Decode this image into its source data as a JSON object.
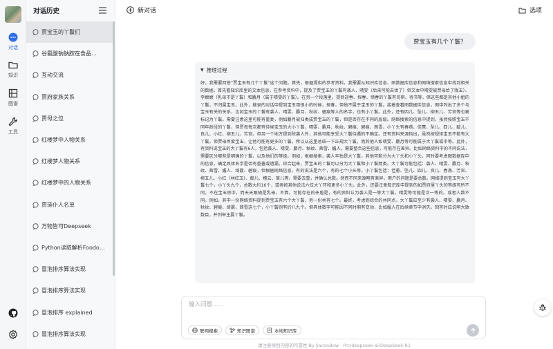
{
  "rail": {
    "items": [
      {
        "icon": "chat-icon",
        "label": "对话"
      },
      {
        "icon": "folder-icon",
        "label": "知识"
      },
      {
        "icon": "graph-icon",
        "label": "图谱"
      },
      {
        "icon": "wrench-icon",
        "label": "工具"
      }
    ],
    "bottom_icons": [
      "github-icon",
      "gear-icon"
    ],
    "accent": "#2f6fed"
  },
  "sidebar": {
    "title": "对话历史",
    "items": [
      {
        "label": "贾宝玉的丫鬟们"
      },
      {
        "label": "谷氨酸钠钠胺在食品…"
      },
      {
        "label": "互动交流"
      },
      {
        "label": "贾府家族关系"
      },
      {
        "label": "贾母之位"
      },
      {
        "label": "红楼梦中人物关系"
      },
      {
        "label": "红楼梦人物关系"
      },
      {
        "label": "红楼梦中的人物关系"
      },
      {
        "label": "贾琏仆人名单"
      },
      {
        "label": "万物皆可Deepseek"
      },
      {
        "label": "Python读取解析Foodo…"
      },
      {
        "label": "冒泡排序算法实现"
      },
      {
        "label": "冒泡排序算法实现"
      },
      {
        "label": "冒泡排序 explained"
      },
      {
        "label": "冒泡排序算法实现"
      }
    ]
  },
  "topbar": {
    "new_chat": "新对话",
    "options": "选项"
  },
  "conversation": {
    "user_message": "贾宝玉有几个丫鬟？",
    "reasoning_label": "推理过程",
    "reasoning_text": "好，我需要回答“贾宝玉有几个丫鬟”这个问题。首先，根据提供的参考资料，我需要从知识库信息、图数据库信息和网络搜索信息中找到相关的数据。首先看知识库里的文本信息，在参考资料中，提及了贾宝玉的丫鬟有袭人、晴雯（后来可能去世了）但文本中晴雯被贾母给了陇玉）、李嬷嬷（乳母不是丫鬟）和麝月（属于晴雯的丫鬟）。在另一个段落里，提到迎春、探春、惜春的丫鬟有司棋、待书等，但这些都是其他小姐的丫鬟，不归属宝玉。此外，搜录的对话中提到宝玉用很小的时候，探春，但他不属于宝玉的丫鬟。接着查看图数据库信息，图中列出了多个与宝玉有关的关系，比如宝玉的丫鬟有袭人、晴雯、麝月、秋纹、碧痕等人的名字，也有小丫鬟。此外，还有四儿、坠儿、柳五儿、芳官等也被标记为丫鬟。需要注意这里可能有重复，例如麝月被归类成贾宝玉的丫鬟，但是否存在不同的层级。网络搜索的信息中提到，虽然按照宝玉不同年龄段的丫鬟，但贾母每次都有侍候宝玉的大小丫鬟，晴雯、麝月、秋纹、碧痕、碧痕、茜雪、小丫头有春燕、佳蕙、坠儿、四儿、靛儿、良儿、小红、柳五儿、芳官。但另一个地方提到除袭人外，其他可能享受大丫鬟待遇的不确定。还有资料来源指出，虽然按规矩宝玉不能有大丫鬟，但贾母疼爱宝玉，让他可能有更多的丫鬟。所以从这里总结一下正规大丫鬟，而其他人如晴雯、麝月等可能属于大丫鬟或中等。此外，有资料说宝玉的大丫鬟有6人，包括袭人、晴雯、麝月、秋纹、茜雪、媚人。需要整合这些信息，可能存在差异。比如网络资料中的不同说法，需要区分哪些是明确的丫鬟，以及他们的等级。例如，根据搜索，袭人丰独是大丫鬟，其他可能分为大丫头和小丫头。同时要考虑图数据库中的信息，确定具体名字是否有重叠或遗漏。综合起来，贾宝玉的丫鬟可以分为大丫鬟和小丫鬟两类。大丫鬟可能包括：袭人、晴雯、麝月、秋纹、茜雪、媚人、绮霰、碧痕，但根据网络信息，有的说法是六个，有的七个小头等。小丫鬟包括：佳蕙、坠儿、四儿、良儿、春燕、芳官、柳五儿、小红（林红玉）、靛儿、檀云、篆儿等。需要去重，并确认总数。然而不同来源略有差异，用户的问题是要总数。网络提到宝玉有大丫鬟七个，小丫头九个，总数大约16个，或者按其他说法六位大丫环和更多小丫头。此外，还要注意知识库中提到的如贾府里丫头的等级有所不同，不在宝玉房中，而天天跟随是乳母，不算。可能存在的矛盾是，有的资料认为袭人是一等大丫鬟，晴雯等可能是次一等的。或者人数不同。例如，其中一份网络资料提到贾宝玉有六个大丫鬟，另一份共有七个。最终，考虑到综合的共同点，大丫鬟应至少有袭人、晴雯、麝月、秋纹、碧痕、绮霰、茜雪这七个，小丫鬟则有约八九个。但具体数字可能因不同时期有变动，比如媚人在后续章节中消失。回答时应说明大致数目，并列举主要丫鬟。"
  },
  "input": {
    "placeholder": "输入问题……",
    "chips": [
      "联网搜索",
      "知识图谱",
      "本地知识库"
    ]
  },
  "footer": "请注意辨别内容的可靠性 By JiaconBow · Prc/deepseek-ai/DeepSeek-R1"
}
